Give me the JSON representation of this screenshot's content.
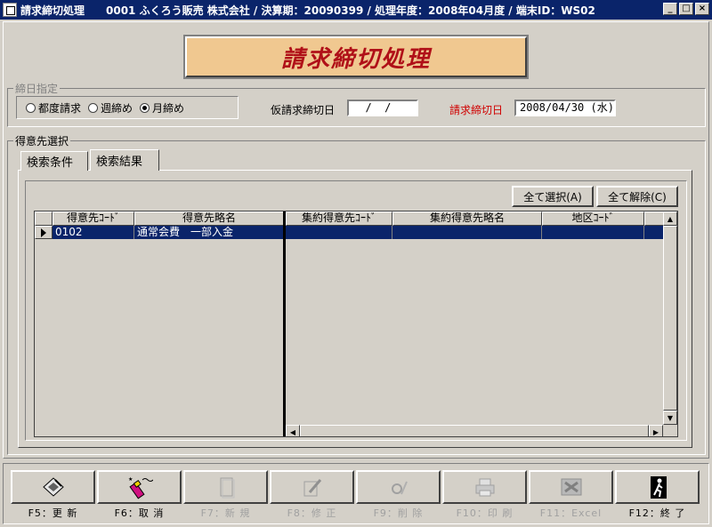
{
  "window": {
    "title": "請求締切処理　　0001 ふくろう販売 株式会社 / 決算期：20090399 / 処理年度：2008年04月度 / 端末ID：WS02"
  },
  "banner": {
    "text": "請求締切処理"
  },
  "shime": {
    "legend": "締日指定",
    "options": [
      "都度請求",
      "週締め",
      "月締め"
    ],
    "selected": "月締め",
    "kari_label": "仮請求締切日",
    "kari_value": "  /  /",
    "seikyu_label": "請求締切日",
    "seikyu_value": "2008/04/30 (水)"
  },
  "tokui": {
    "legend": "得意先選択",
    "tabs": [
      "検索条件",
      "検索結果"
    ],
    "active_tab": "検索結果",
    "buttons": {
      "select_all": "全て選択(A)",
      "clear_all": "全て解除(C)"
    },
    "left_columns": [
      "得意先ｺｰﾄﾞ",
      "得意先略名"
    ],
    "right_columns": [
      "集約得意先ｺｰﾄﾞ",
      "集約得意先略名",
      "地区ｺｰﾄﾞ"
    ],
    "rows": [
      {
        "code": "0102",
        "name": "通常会費　一部入金",
        "agg_code": "",
        "agg_name": "",
        "area": ""
      }
    ]
  },
  "fkeys": [
    {
      "label": "F5：更 新",
      "icon": "floppy-disk-icon",
      "enabled": true
    },
    {
      "label": "F6：取 消",
      "icon": "eraser-icon",
      "enabled": true
    },
    {
      "label": "F7：新 規",
      "icon": "new-document-icon",
      "enabled": false
    },
    {
      "label": "F8：修 正",
      "icon": "edit-document-icon",
      "enabled": false
    },
    {
      "label": "F9：削 除",
      "icon": "trash-icon",
      "enabled": false
    },
    {
      "label": "F10：印 刷",
      "icon": "printer-icon",
      "enabled": false
    },
    {
      "label": "F11：Excel",
      "icon": "excel-icon",
      "enabled": false
    },
    {
      "label": "F12：終 了",
      "icon": "exit-door-icon",
      "enabled": true
    }
  ],
  "colors": {
    "titlebar": "#0a246a",
    "banner_bg": "#f0c890",
    "banner_text": "#b01018",
    "selection": "#0a246a",
    "alert_label": "#d00000"
  }
}
